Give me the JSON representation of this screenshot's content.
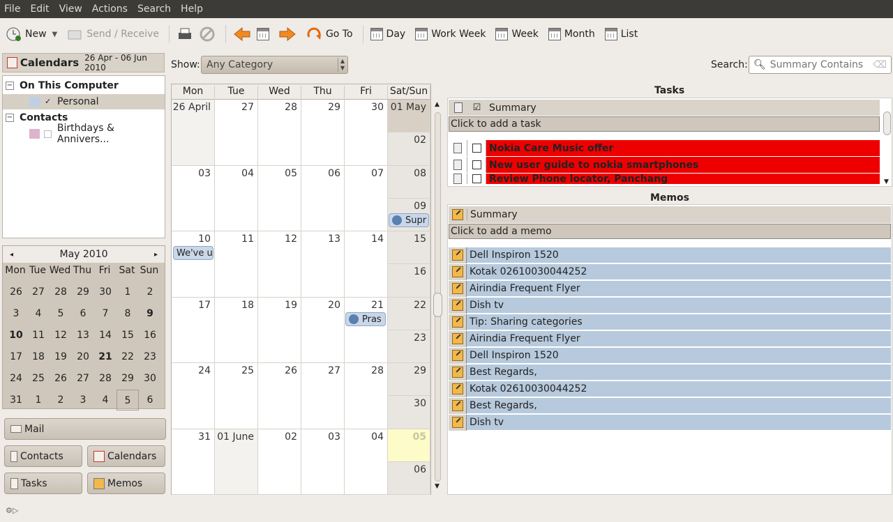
{
  "menu": [
    "File",
    "Edit",
    "View",
    "Actions",
    "Search",
    "Help"
  ],
  "toolbar": {
    "new": "New",
    "send": "Send / Receive",
    "goto": "Go To",
    "day": "Day",
    "workweek": "Work Week",
    "week": "Week",
    "month": "Month",
    "list": "List"
  },
  "left": {
    "header": "Calendars",
    "range": "26 Apr - 06 Jun 2010",
    "group1": "On This Computer",
    "personal": "Personal",
    "group2": "Contacts",
    "birthdays": "Birthdays & Annivers..."
  },
  "mini": {
    "title": "May 2010",
    "dows": [
      "Mon",
      "Tue",
      "Wed",
      "Thu",
      "Fri",
      "Sat",
      "Sun"
    ],
    "weeks": [
      [
        "26",
        "27",
        "28",
        "29",
        "30",
        "1",
        "2"
      ],
      [
        "3",
        "4",
        "5",
        "6",
        "7",
        "8",
        "9"
      ],
      [
        "10",
        "11",
        "12",
        "13",
        "14",
        "15",
        "16"
      ],
      [
        "17",
        "18",
        "19",
        "20",
        "21",
        "22",
        "23"
      ],
      [
        "24",
        "25",
        "26",
        "27",
        "28",
        "29",
        "30"
      ],
      [
        "31",
        "1",
        "2",
        "3",
        "4",
        "5",
        "6"
      ]
    ]
  },
  "switcher": {
    "mail": "Mail",
    "contacts": "Contacts",
    "calendars": "Calendars",
    "tasks": "Tasks",
    "memos": "Memos"
  },
  "show": {
    "label": "Show:",
    "value": "Any Category"
  },
  "search": {
    "label": "Search:",
    "placeholder": "Summary Contains"
  },
  "cal": {
    "dows": [
      "Mon",
      "Tue",
      "Wed",
      "Thu",
      "Fri",
      "Sat/Sun"
    ],
    "weeks": [
      {
        "d": [
          "26 April",
          "27",
          "28",
          "29",
          "30"
        ],
        "sat": "01 May",
        "sun": "02"
      },
      {
        "d": [
          "03",
          "04",
          "05",
          "06",
          "07"
        ],
        "sat": "08",
        "sun": "09"
      },
      {
        "d": [
          "10",
          "11",
          "12",
          "13",
          "14"
        ],
        "sat": "15",
        "sun": "16"
      },
      {
        "d": [
          "17",
          "18",
          "19",
          "20",
          "21"
        ],
        "sat": "22",
        "sun": "23"
      },
      {
        "d": [
          "24",
          "25",
          "26",
          "27",
          "28"
        ],
        "sat": "29",
        "sun": "30"
      },
      {
        "d": [
          "31",
          "01 June",
          "02",
          "03",
          "04"
        ],
        "sat": "05",
        "sun": "06"
      }
    ],
    "events": {
      "e1": "Supr",
      "e2": "We've u",
      "e3": "Pras"
    }
  },
  "tasks": {
    "title": "Tasks",
    "col": "Summary",
    "add": "Click to add a task",
    "items": [
      "Nokia Care Music offer",
      "New user guide to nokia smartphones",
      "Review Phone locator, Panchang"
    ]
  },
  "memos": {
    "title": "Memos",
    "col": "Summary",
    "add": "Click to add a memo",
    "items": [
      "Dell Inspiron 1520",
      "Kotak 02610030044252",
      "Airindia Frequent Flyer",
      "Dish tv",
      "Tip: Sharing categories",
      "Airindia Frequent Flyer",
      "Dell Inspiron 1520",
      "Best Regards,",
      "Kotak 02610030044252",
      "Best Regards,",
      "Dish tv"
    ]
  },
  "colors": {
    "personal": "#c0d0e4",
    "birthdays": "#dcb4cc",
    "task_overdue": "#ee0000",
    "memo_row": "#b7c9dc"
  }
}
